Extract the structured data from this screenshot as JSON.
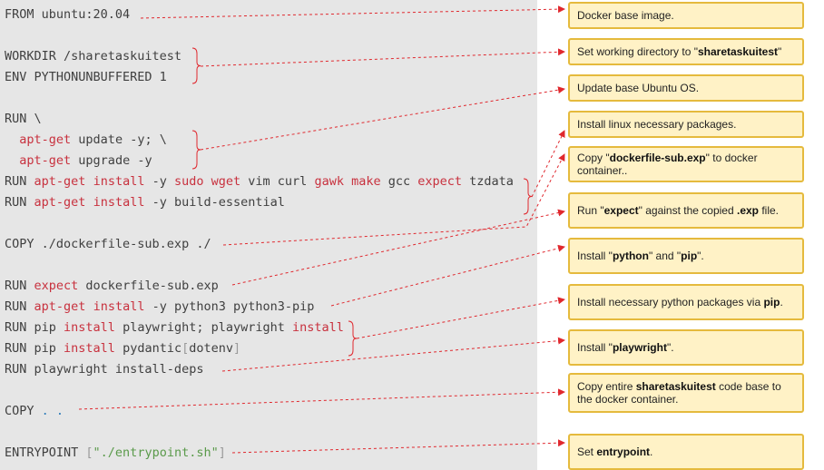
{
  "code_lines": [
    [
      {
        "t": "FROM ubuntu:20.04"
      }
    ],
    [
      {
        "t": ""
      }
    ],
    [
      {
        "t": "WORKDIR /sharetaskuitest"
      }
    ],
    [
      {
        "t": "ENV PYTHONUNBUFFERED 1"
      }
    ],
    [
      {
        "t": ""
      }
    ],
    [
      {
        "t": "RUN \\"
      }
    ],
    [
      {
        "t": "  "
      },
      {
        "t": "apt-get",
        "c": "kw"
      },
      {
        "t": " update -y; \\"
      }
    ],
    [
      {
        "t": "  "
      },
      {
        "t": "apt-get",
        "c": "kw"
      },
      {
        "t": " upgrade -y"
      }
    ],
    [
      {
        "t": "RUN "
      },
      {
        "t": "apt-get",
        "c": "kw"
      },
      {
        "t": " "
      },
      {
        "t": "install",
        "c": "kw"
      },
      {
        "t": " -y "
      },
      {
        "t": "sudo",
        "c": "kw"
      },
      {
        "t": " "
      },
      {
        "t": "wget",
        "c": "kw"
      },
      {
        "t": " vim curl "
      },
      {
        "t": "gawk",
        "c": "kw"
      },
      {
        "t": " "
      },
      {
        "t": "make",
        "c": "kw"
      },
      {
        "t": " gcc "
      },
      {
        "t": "expect",
        "c": "kw"
      },
      {
        "t": " tzdata"
      }
    ],
    [
      {
        "t": "RUN "
      },
      {
        "t": "apt-get",
        "c": "kw"
      },
      {
        "t": " "
      },
      {
        "t": "install",
        "c": "kw"
      },
      {
        "t": " -y build-essential"
      }
    ],
    [
      {
        "t": ""
      }
    ],
    [
      {
        "t": "COPY ./dockerfile-sub.exp ./"
      }
    ],
    [
      {
        "t": ""
      }
    ],
    [
      {
        "t": "RUN "
      },
      {
        "t": "expect",
        "c": "kw"
      },
      {
        "t": " dockerfile-sub.exp"
      }
    ],
    [
      {
        "t": "RUN "
      },
      {
        "t": "apt-get",
        "c": "kw"
      },
      {
        "t": " "
      },
      {
        "t": "install",
        "c": "kw"
      },
      {
        "t": " -y python3 python3-pip"
      }
    ],
    [
      {
        "t": "RUN pip "
      },
      {
        "t": "install",
        "c": "kw"
      },
      {
        "t": " playwright; playwright "
      },
      {
        "t": "install",
        "c": "kw"
      }
    ],
    [
      {
        "t": "RUN pip "
      },
      {
        "t": "install",
        "c": "kw"
      },
      {
        "t": " pydantic"
      },
      {
        "t": "[",
        "c": "dim"
      },
      {
        "t": "dotenv"
      },
      {
        "t": "]",
        "c": "dim"
      }
    ],
    [
      {
        "t": "RUN playwright install-deps"
      }
    ],
    [
      {
        "t": ""
      }
    ],
    [
      {
        "t": "COPY "
      },
      {
        "t": ". .",
        "c": "op"
      }
    ],
    [
      {
        "t": ""
      }
    ],
    [
      {
        "t": "ENTRYPOINT "
      },
      {
        "t": "[",
        "c": "dim"
      },
      {
        "t": "\"./entrypoint.sh\"",
        "c": "str"
      },
      {
        "t": "]",
        "c": "dim"
      }
    ]
  ],
  "notes": [
    {
      "parts": [
        {
          "t": "Docker base image."
        }
      ]
    },
    {
      "parts": [
        {
          "t": "Set working directory to \""
        },
        {
          "t": "sharetaskuitest",
          "b": true
        },
        {
          "t": "\""
        }
      ]
    },
    {
      "parts": [
        {
          "t": "Update base Ubuntu OS."
        }
      ]
    },
    {
      "parts": [
        {
          "t": "Install linux necessary packages."
        }
      ]
    },
    {
      "parts": [
        {
          "t": "Copy \""
        },
        {
          "t": "dockerfile-sub.exp",
          "b": true
        },
        {
          "t": "\" to docker container.."
        }
      ]
    },
    {
      "parts": [
        {
          "t": "Run \""
        },
        {
          "t": "expect",
          "b": true
        },
        {
          "t": "\" against the copied "
        },
        {
          "t": ".exp",
          "b": true
        },
        {
          "t": " file."
        }
      ]
    },
    {
      "parts": [
        {
          "t": "Install \""
        },
        {
          "t": "python",
          "b": true
        },
        {
          "t": "\" and \""
        },
        {
          "t": "pip",
          "b": true
        },
        {
          "t": "\"."
        }
      ]
    },
    {
      "parts": [
        {
          "t": "Install necessary python packages via "
        },
        {
          "t": "pip",
          "b": true
        },
        {
          "t": "."
        }
      ]
    },
    {
      "parts": [
        {
          "t": "Install \""
        },
        {
          "t": "playwright",
          "b": true
        },
        {
          "t": "\"."
        }
      ]
    },
    {
      "parts": [
        {
          "t": "Copy entire "
        },
        {
          "t": "sharetaskuitest",
          "b": true
        },
        {
          "t": " code base to the docker container."
        }
      ]
    },
    {
      "parts": [
        {
          "t": "Set "
        },
        {
          "t": "entrypoint",
          "b": true
        },
        {
          "t": "."
        }
      ]
    }
  ],
  "colors": {
    "keyword": "#c8313e",
    "connector": "#e0282e",
    "note_fill": "#fff2c6",
    "note_border": "#e5ba3d",
    "panel": "#e6e6e6"
  }
}
